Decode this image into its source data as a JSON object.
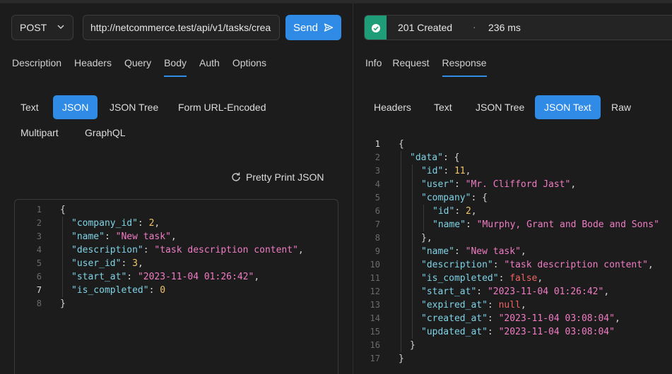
{
  "request": {
    "method": "POST",
    "url": "http://netcommerce.test/api/v1/tasks/crea",
    "send_label": "Send",
    "tabs": [
      "Description",
      "Headers",
      "Query",
      "Body",
      "Auth",
      "Options"
    ],
    "active_tab": "Body",
    "body_types": [
      "Text",
      "JSON",
      "JSON Tree",
      "Form URL-Encoded",
      "Multipart",
      "GraphQL"
    ],
    "active_body_type": "JSON",
    "pretty_print_label": "Pretty Print JSON",
    "editor_lines": [
      {
        "num": "1"
      },
      {
        "num": "2"
      },
      {
        "num": "3"
      },
      {
        "num": "4"
      },
      {
        "num": "5"
      },
      {
        "num": "6"
      },
      {
        "num": "7"
      },
      {
        "num": "8"
      }
    ],
    "body": {
      "open": "{",
      "company_id_key": "\"company_id\"",
      "company_id_val": "2",
      "name_key": "\"name\"",
      "name_val": "\"New task\"",
      "description_key": "\"description\"",
      "description_val": "\"task description content\"",
      "user_id_key": "\"user_id\"",
      "user_id_val": "3",
      "start_at_key": "\"start_at\"",
      "start_at_val": "\"2023-11-04 01:26:42\"",
      "is_completed_key": "\"is_completed\"",
      "is_completed_val": "0",
      "close": "}"
    },
    "current_line": "7"
  },
  "response": {
    "status_text": "201 Created",
    "separator": "·",
    "time": "236 ms",
    "status_color": "#1f9d78",
    "tabs": [
      "Info",
      "Request",
      "Response"
    ],
    "active_tab": "Response",
    "view_types": [
      "Headers",
      "Text",
      "JSON Tree",
      "JSON Text",
      "Raw"
    ],
    "active_view_type": "JSON Text",
    "line_numbers": [
      "1",
      "2",
      "3",
      "4",
      "5",
      "6",
      "7",
      "8",
      "9",
      "10",
      "11",
      "12",
      "13",
      "14",
      "15",
      "16",
      "17"
    ],
    "json": {
      "open": "{",
      "data_key": "\"data\"",
      "id_key": "\"id\"",
      "id_val": "11",
      "user_key": "\"user\"",
      "user_val": "\"Mr. Clifford Jast\"",
      "company_key": "\"company\"",
      "company_id_key": "\"id\"",
      "company_id_val": "2",
      "company_name_key": "\"name\"",
      "company_name_val": "\"Murphy, Grant and Bode and Sons\"",
      "name_key": "\"name\"",
      "name_val": "\"New task\"",
      "description_key": "\"description\"",
      "description_val": "\"task description content\"",
      "is_completed_key": "\"is_completed\"",
      "is_completed_val": "false",
      "start_at_key": "\"start_at\"",
      "start_at_val": "\"2023-11-04 01:26:42\"",
      "expired_at_key": "\"expired_at\"",
      "expired_at_val": "null",
      "created_at_key": "\"created_at\"",
      "created_at_val": "\"2023-11-04 03:08:04\"",
      "updated_at_key": "\"updated_at\"",
      "updated_at_val": "\"2023-11-04 03:08:04\"",
      "close": "}"
    }
  },
  "colors": {
    "accent": "#2f8be6",
    "key": "#7fd3e6",
    "string": "#f07cc4",
    "number": "#f0c56a",
    "keyword": "#f06363"
  }
}
